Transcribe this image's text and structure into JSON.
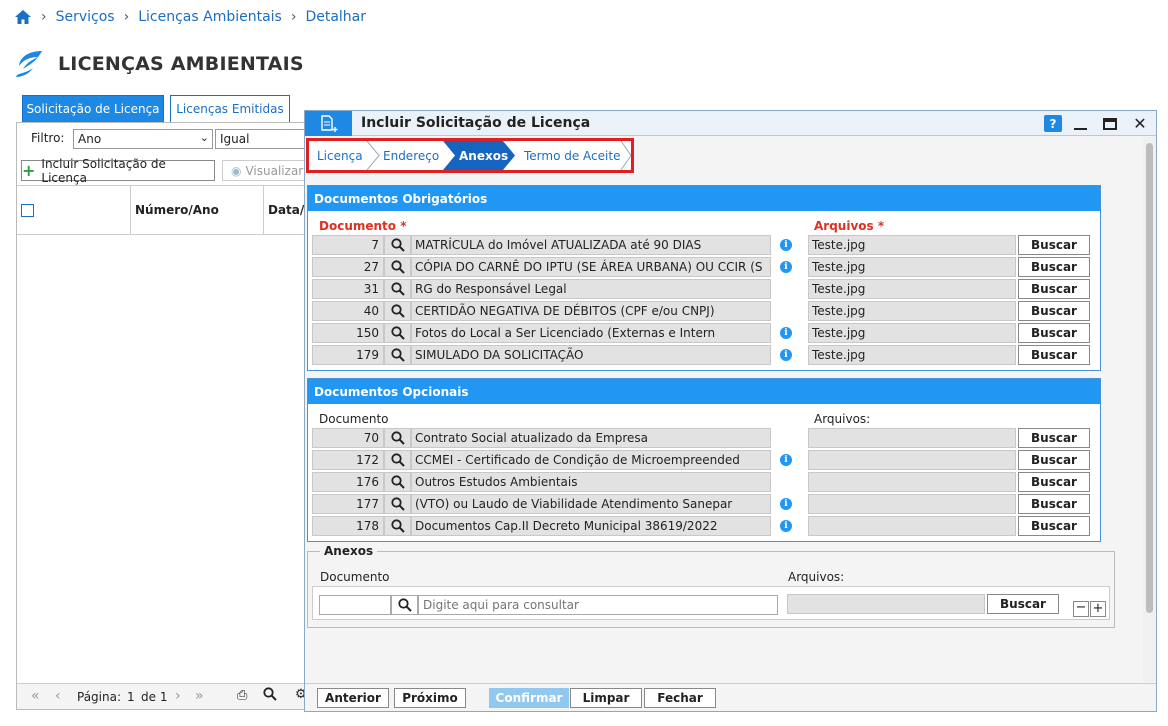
{
  "breadcrumb": {
    "items": [
      "Serviços",
      "Licenças Ambientais",
      "Detalhar"
    ]
  },
  "page": {
    "title": "LICENÇAS AMBIENTAIS"
  },
  "background": {
    "tabs": [
      "Solicitação de Licença",
      "Licenças Emitidas"
    ],
    "filter_label": "Filtro:",
    "filter_field": "Ano",
    "filter_op": "Igual",
    "include_button": "Incluir Solicitação de Licença",
    "view_button": "Visualizar",
    "columns": [
      "Número/Ano",
      "Data/H"
    ],
    "pager": {
      "label": "Página:",
      "page": "1",
      "of": "de 1"
    }
  },
  "dialog": {
    "title": "Incluir Solicitação de Licença",
    "help": "?",
    "wizard": [
      "Licença",
      "Endereço",
      "Anexos",
      "Termo de Aceite"
    ],
    "obrigatorios": {
      "title": "Documentos Obrigatórios",
      "doc_label": "Documento",
      "files_label": "Arquivos",
      "required_mark": "*",
      "rows": [
        {
          "num": "7",
          "desc": "MATRÍCULA do Imóvel ATUALIZADA até 90 DIAS",
          "info": true,
          "file": "Teste.jpg"
        },
        {
          "num": "27",
          "desc": "CÓPIA DO CARNÊ DO IPTU (SE ÁREA URBANA) OU CCIR (S",
          "info": true,
          "file": "Teste.jpg"
        },
        {
          "num": "31",
          "desc": "RG do Responsável Legal",
          "info": false,
          "file": "Teste.jpg"
        },
        {
          "num": "40",
          "desc": "CERTIDÃO NEGATIVA DE DÉBITOS (CPF e/ou CNPJ)",
          "info": false,
          "file": "Teste.jpg"
        },
        {
          "num": "150",
          "desc": "Fotos do Local a Ser Licenciado (Externas e Intern",
          "info": true,
          "file": "Teste.jpg"
        },
        {
          "num": "179",
          "desc": "SIMULADO DA SOLICITAÇÃO",
          "info": true,
          "file": "Teste.jpg"
        }
      ]
    },
    "opcionais": {
      "title": "Documentos Opcionais",
      "doc_label": "Documento",
      "files_label": "Arquivos:",
      "rows": [
        {
          "num": "70",
          "desc": "Contrato Social atualizado da Empresa",
          "info": false,
          "file": ""
        },
        {
          "num": "172",
          "desc": "CCMEI - Certificado de Condição de Microempreended",
          "info": true,
          "file": ""
        },
        {
          "num": "176",
          "desc": "Outros Estudos Ambientais",
          "info": false,
          "file": ""
        },
        {
          "num": "177",
          "desc": "(VTO) ou Laudo de Viabilidade Atendimento Sanepar",
          "info": true,
          "file": ""
        },
        {
          "num": "178",
          "desc": "Documentos Cap.II  Decreto Municipal 38619/2022",
          "info": true,
          "file": ""
        }
      ]
    },
    "anexos": {
      "legend": "Anexos",
      "doc_label": "Documento",
      "files_label": "Arquivos:",
      "placeholder": "Digite aqui para consultar"
    },
    "buscar_label": "Buscar",
    "footer": {
      "anterior": "Anterior",
      "proximo": "Próximo",
      "confirmar": "Confirmar",
      "limpar": "Limpar",
      "fechar": "Fechar"
    }
  },
  "colors": {
    "accent": "#1e88e5",
    "required": "#e0301e",
    "highlight": "#e02020"
  }
}
